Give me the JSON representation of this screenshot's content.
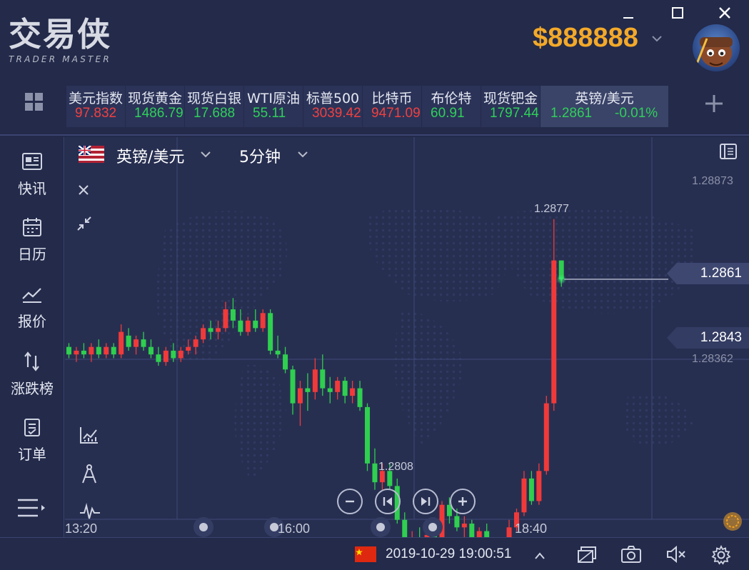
{
  "app": {
    "logo_text": "交易侠",
    "logo_subtitle": "TRADER MASTER",
    "balance": "$888888",
    "window_buttons": [
      "minimize",
      "maximize",
      "close"
    ]
  },
  "tickers": [
    {
      "name": "美元指数",
      "price": "97.832",
      "direction": "down"
    },
    {
      "name": "现货黄金",
      "price": "1486.79",
      "direction": "up"
    },
    {
      "name": "现货白银",
      "price": "17.688",
      "direction": "up"
    },
    {
      "name": "WTI原油",
      "price": "55.11",
      "direction": "up"
    },
    {
      "name": "标普500",
      "price": "3039.42",
      "direction": "down"
    },
    {
      "name": "比特币",
      "price": "9471.09",
      "direction": "down"
    },
    {
      "name": "布伦特",
      "price": "60.91",
      "direction": "up"
    },
    {
      "name": "现货钯金",
      "price": "1797.44",
      "direction": "up"
    }
  ],
  "active_ticker": {
    "name": "英镑/美元",
    "price": "1.2861",
    "change": "-0.01%"
  },
  "sidebar": {
    "items": [
      {
        "label": "快讯",
        "icon": "news-icon"
      },
      {
        "label": "日历",
        "icon": "calendar-icon"
      },
      {
        "label": "报价",
        "icon": "quote-icon"
      },
      {
        "label": "涨跌榜",
        "icon": "ranking-icon"
      },
      {
        "label": "订单",
        "icon": "order-icon"
      }
    ]
  },
  "chart_header": {
    "symbol": "英镑/美元",
    "period": "5分钟"
  },
  "chart_data": {
    "type": "candlestick",
    "symbol": "英镑/美元",
    "period": "5分钟",
    "y_axis_labels": [
      "1.28873",
      "1.28362"
    ],
    "current_price": "1.2861",
    "marker_price": "1.2843",
    "high_label": "1.2877",
    "low_label": "1.2808",
    "x_tick_labels": [
      "13:20",
      "16:00",
      "18:40"
    ],
    "ylim": [
      1.28,
      1.2895
    ],
    "candles": [
      [
        1.2843,
        1.2844,
        1.284,
        1.2841
      ],
      [
        1.2841,
        1.2843,
        1.2839,
        1.2842
      ],
      [
        1.2842,
        1.2844,
        1.284,
        1.2841
      ],
      [
        1.2841,
        1.2844,
        1.2839,
        1.2843
      ],
      [
        1.2843,
        1.2845,
        1.284,
        1.2841
      ],
      [
        1.2841,
        1.2844,
        1.284,
        1.2843
      ],
      [
        1.2843,
        1.2844,
        1.284,
        1.2841
      ],
      [
        1.2841,
        1.2849,
        1.284,
        1.2847
      ],
      [
        1.2846,
        1.2848,
        1.2842,
        1.2843
      ],
      [
        1.2843,
        1.2846,
        1.2841,
        1.2845
      ],
      [
        1.2845,
        1.2847,
        1.2842,
        1.2843
      ],
      [
        1.2843,
        1.2845,
        1.284,
        1.2841
      ],
      [
        1.2841,
        1.2843,
        1.2838,
        1.2839
      ],
      [
        1.2839,
        1.2843,
        1.2838,
        1.2842
      ],
      [
        1.2842,
        1.2844,
        1.2839,
        1.284
      ],
      [
        1.284,
        1.2843,
        1.2839,
        1.2842
      ],
      [
        1.2842,
        1.2845,
        1.2841,
        1.2843
      ],
      [
        1.2843,
        1.2846,
        1.2841,
        1.2845
      ],
      [
        1.2845,
        1.2849,
        1.2844,
        1.2848
      ],
      [
        1.2848,
        1.285,
        1.2845,
        1.2847
      ],
      [
        1.2847,
        1.285,
        1.2845,
        1.2848
      ],
      [
        1.2848,
        1.2855,
        1.2847,
        1.2853
      ],
      [
        1.2853,
        1.2856,
        1.2848,
        1.285
      ],
      [
        1.285,
        1.2853,
        1.2846,
        1.2847
      ],
      [
        1.2847,
        1.2851,
        1.2846,
        1.285
      ],
      [
        1.285,
        1.2853,
        1.2847,
        1.2848
      ],
      [
        1.2848,
        1.2853,
        1.2847,
        1.2852
      ],
      [
        1.2852,
        1.2853,
        1.2841,
        1.2842
      ],
      [
        1.2842,
        1.2846,
        1.284,
        1.2841
      ],
      [
        1.2841,
        1.2843,
        1.2836,
        1.2837
      ],
      [
        1.2837,
        1.2838,
        1.2825,
        1.2828
      ],
      [
        1.2828,
        1.2834,
        1.2822,
        1.2832
      ],
      [
        1.2832,
        1.2836,
        1.2826,
        1.2831
      ],
      [
        1.2831,
        1.284,
        1.2829,
        1.2837
      ],
      [
        1.2837,
        1.2841,
        1.283,
        1.2832
      ],
      [
        1.2832,
        1.2835,
        1.2828,
        1.2831
      ],
      [
        1.2831,
        1.2835,
        1.2829,
        1.2834
      ],
      [
        1.2834,
        1.2835,
        1.2828,
        1.283
      ],
      [
        1.283,
        1.2834,
        1.2828,
        1.2832
      ],
      [
        1.2832,
        1.2834,
        1.2826,
        1.2827
      ],
      [
        1.2827,
        1.2828,
        1.281,
        1.2812
      ],
      [
        1.2812,
        1.2816,
        1.2805,
        1.2807
      ],
      [
        1.2807,
        1.2812,
        1.2805,
        1.281
      ],
      [
        1.281,
        1.2812,
        1.2805,
        1.2806
      ],
      [
        1.2806,
        1.2808,
        1.2796,
        1.2797
      ],
      [
        1.2797,
        1.2799,
        1.2786,
        1.2788
      ],
      [
        1.2788,
        1.2794,
        1.2784,
        1.2792
      ],
      [
        1.2792,
        1.2795,
        1.2787,
        1.2789
      ],
      [
        1.2789,
        1.2795,
        1.2787,
        1.2793
      ],
      [
        1.2793,
        1.2795,
        1.2788,
        1.279
      ],
      [
        1.279,
        1.2802,
        1.2789,
        1.2801
      ],
      [
        1.2801,
        1.2803,
        1.2796,
        1.2798
      ],
      [
        1.2798,
        1.28,
        1.2794,
        1.2795
      ],
      [
        1.2795,
        1.2798,
        1.2792,
        1.2796
      ],
      [
        1.2796,
        1.2797,
        1.279,
        1.2791
      ],
      [
        1.2791,
        1.2795,
        1.2789,
        1.2794
      ],
      [
        1.2794,
        1.2796,
        1.279,
        1.2791
      ],
      [
        1.2791,
        1.2792,
        1.2783,
        1.2785
      ],
      [
        1.2785,
        1.279,
        1.2784,
        1.2789
      ],
      [
        1.2789,
        1.2797,
        1.2788,
        1.2795
      ],
      [
        1.2795,
        1.28,
        1.2794,
        1.2799
      ],
      [
        1.2799,
        1.281,
        1.2798,
        1.2808
      ],
      [
        1.2808,
        1.281,
        1.2801,
        1.2802
      ],
      [
        1.2802,
        1.2812,
        1.2801,
        1.281
      ],
      [
        1.281,
        1.283,
        1.2809,
        1.2828
      ],
      [
        1.2828,
        1.2877,
        1.2826,
        1.2866
      ],
      [
        1.2866,
        1.2866,
        1.2859,
        1.2861
      ]
    ]
  },
  "chart_controls": [
    "zoom-out",
    "step-back",
    "step-forward",
    "zoom-in"
  ],
  "statusbar": {
    "datetime": "2019-10-29 19:00:51"
  }
}
